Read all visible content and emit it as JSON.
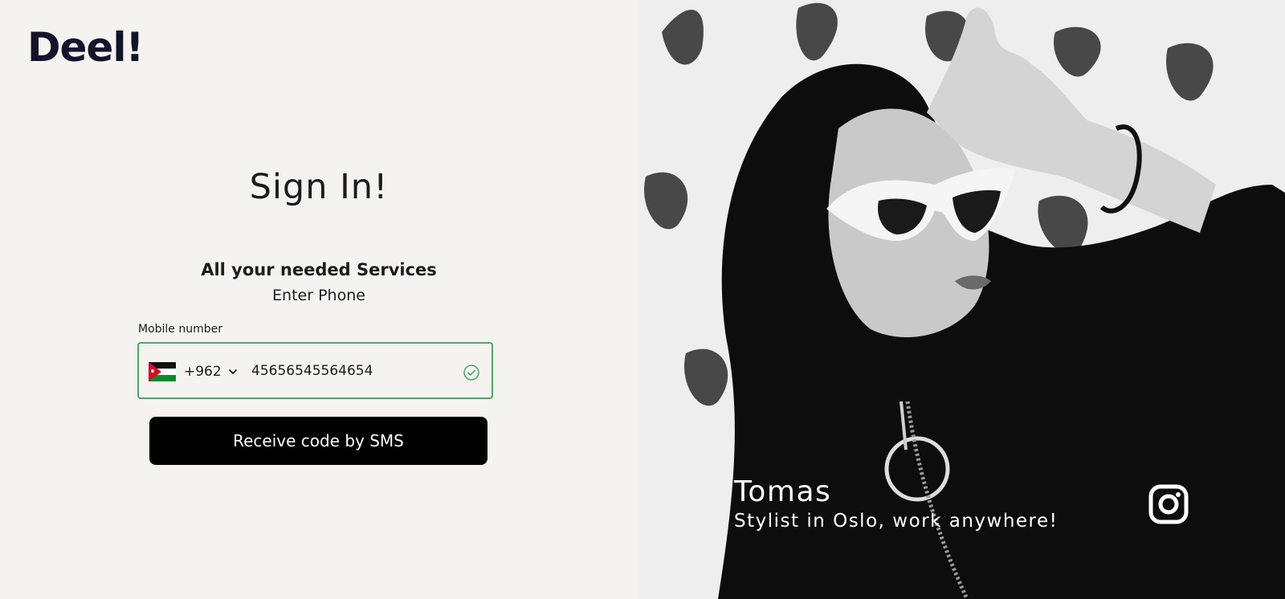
{
  "brand": {
    "logo": "Deel!"
  },
  "signin": {
    "title": "Sign In!",
    "subtitle": "All your needed Services",
    "instruction": "Enter Phone",
    "field_label": "Mobile number",
    "country_code": "+962",
    "country_flag": "jordan-flag",
    "phone_value": "45656545564654",
    "valid": true,
    "submit_label": "Receive code by SMS"
  },
  "hero": {
    "name": "Tomas",
    "tagline": "Stylist in Oslo, work anywhere!",
    "social_icon": "instagram-icon"
  },
  "colors": {
    "background": "#f4f3ef",
    "brand_text": "#14132b",
    "valid_border": "#4ca86a",
    "button": "#000000"
  }
}
